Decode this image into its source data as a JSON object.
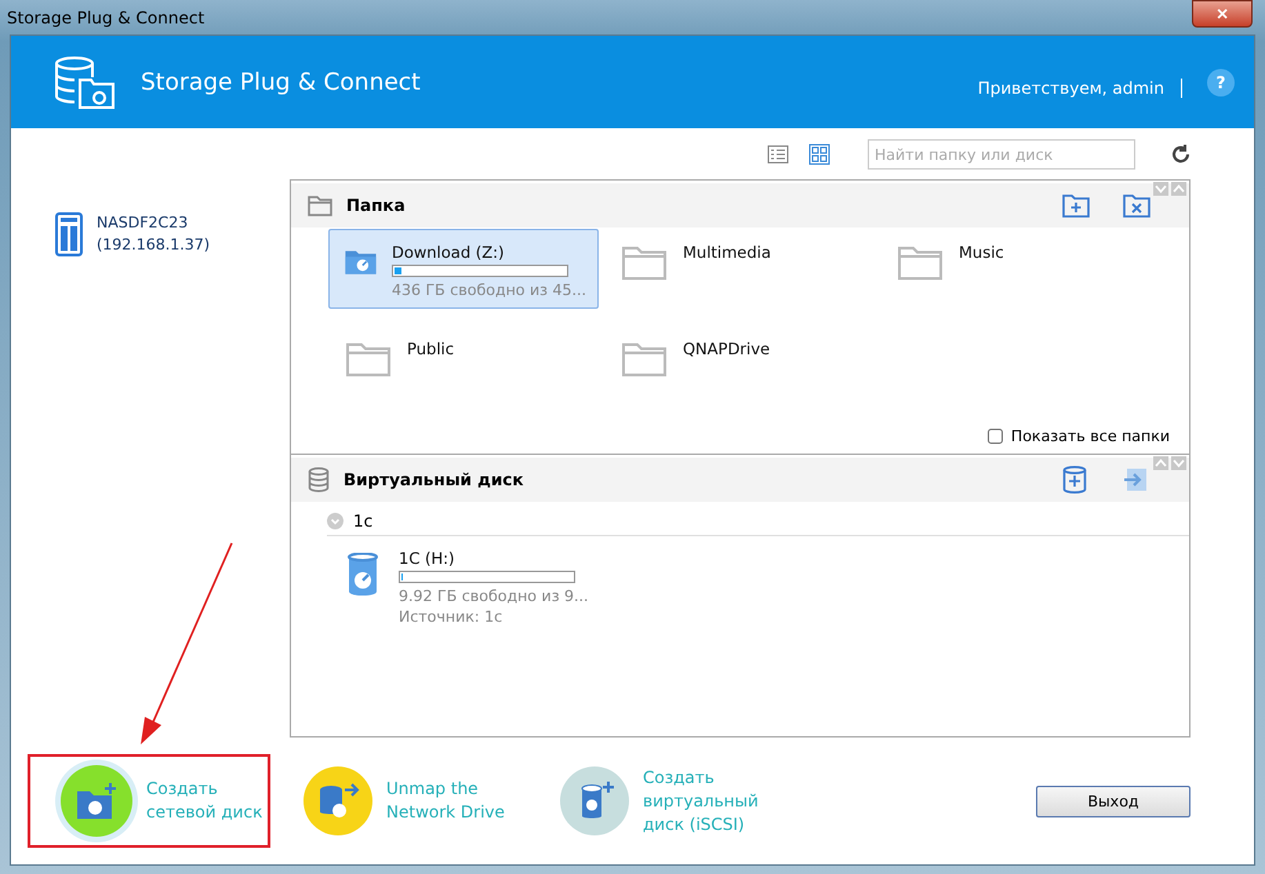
{
  "window": {
    "title": "Storage Plug & Connect",
    "close": "✕"
  },
  "header": {
    "app_title": "Storage Plug & Connect",
    "greeting": "Приветствуем, admin",
    "help": "?"
  },
  "toolbar": {
    "views": [
      {
        "kind": "list",
        "selected": false
      },
      {
        "kind": "grid",
        "selected": true
      }
    ],
    "search": {
      "placeholder": "Найти папку или диск"
    }
  },
  "device": {
    "name": "NASDF2C23",
    "address": "(192.168.1.37)"
  },
  "folders": {
    "title": "Папка",
    "items": [
      {
        "name": "Download (Z:)",
        "selected": true,
        "mapped": true,
        "level": 0.04,
        "info": "436 ГБ свободно из 45..."
      },
      {
        "name": "Multimedia",
        "selected": false,
        "mapped": false
      },
      {
        "name": "Music",
        "selected": false,
        "mapped": false
      },
      {
        "name": "Public",
        "selected": false,
        "mapped": false
      },
      {
        "name": "QNAPDrive",
        "selected": false,
        "mapped": false
      }
    ],
    "show_all": {
      "label": "Показать все папки",
      "checked": false
    }
  },
  "virtual_disks": {
    "title": "Виртуальный диск",
    "groups": [
      {
        "name": "1c",
        "expanded": true,
        "items": [
          {
            "name": "1C (H:)",
            "level": 0,
            "info": "9.92 ГБ свободно из 9...",
            "source": "Источник: 1c"
          }
        ]
      }
    ]
  },
  "actions": [
    {
      "kind": "create",
      "label": "Создать сетевой диск",
      "color": "#86e02c",
      "highlighted": true
    },
    {
      "kind": "unmap",
      "label": "Unmap the Network Drive",
      "color": "#f7d417",
      "highlighted": false
    },
    {
      "kind": "virtual",
      "label": "Создать виртуальный диск (iSCSI)",
      "color": "#c7dede",
      "highlighted": false
    }
  ],
  "exit_button": "Выход"
}
